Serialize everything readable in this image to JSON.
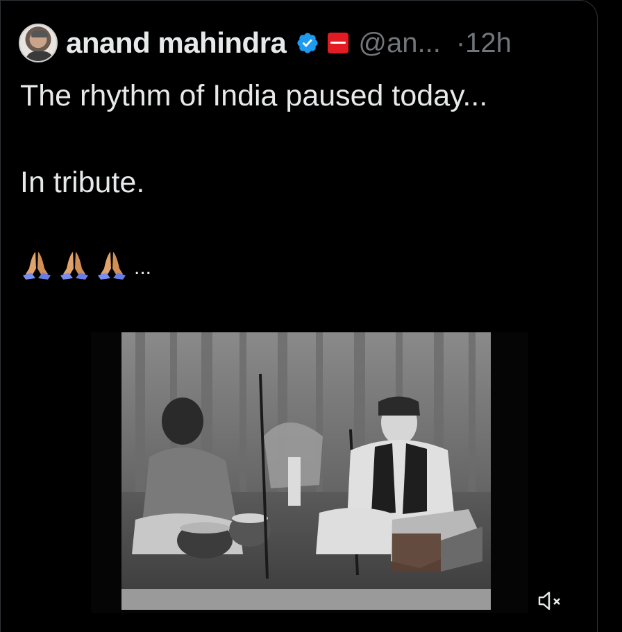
{
  "post": {
    "author": {
      "display_name": "anand mahindra",
      "handle": "@an...",
      "verified": true,
      "affiliate_badge": "mahindra",
      "avatar_icon": "avatar-icon"
    },
    "timestamp": "·12h",
    "text": {
      "line1": "The rhythm of India paused today...",
      "line2": "In tribute.",
      "emoji": "🙏🙏🙏",
      "ellipsis": "..."
    },
    "media": {
      "type": "video",
      "muted": true,
      "mute_icon": "volume-muted-icon"
    }
  },
  "colors": {
    "background": "#000000",
    "text_primary": "#e7e9ea",
    "text_secondary": "#71767b",
    "verified_blue": "#1d9bf0",
    "affiliate_red": "#e31b23"
  }
}
